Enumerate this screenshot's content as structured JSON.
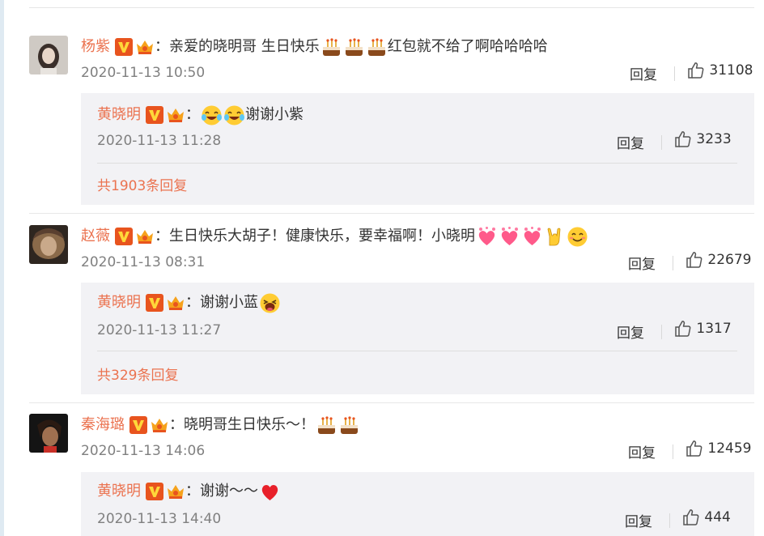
{
  "comments": [
    {
      "username": "杨紫",
      "text": "：亲爱的晓明哥 生日快乐",
      "emojis": [
        "cake-emoji",
        "cake-emoji",
        "cake-emoji"
      ],
      "text_after": "红包就不给了啊哈哈哈哈",
      "time": "2020-11-13 10:50",
      "reply_label": "回复",
      "likes": "31108",
      "reply": {
        "username": "黄晓明",
        "text": "：",
        "emojis": [
          "laugh-cry-emoji",
          "laugh-cry-emoji"
        ],
        "text_after": "谢谢小紫",
        "time": "2020-11-13 11:28",
        "reply_label": "回复",
        "likes": "3233"
      },
      "more_replies": "共1903条回复"
    },
    {
      "username": "赵薇",
      "text": "：生日快乐大胡子！健康快乐，要幸福啊！小晓明",
      "emojis": [
        "heart-cluster-emoji",
        "heart-cluster-emoji",
        "heart-cluster-emoji",
        "rock-hand-emoji",
        "smile-emoji"
      ],
      "text_after": "",
      "time": "2020-11-13 08:31",
      "reply_label": "回复",
      "likes": "22679",
      "reply": {
        "username": "黄晓明",
        "text": "：谢谢小蓝",
        "emojis": [
          "grin-emoji"
        ],
        "text_after": "",
        "time": "2020-11-13 11:27",
        "reply_label": "回复",
        "likes": "1317"
      },
      "more_replies": "共329条回复"
    },
    {
      "username": "秦海璐",
      "text": "：晓明哥生日快乐～！",
      "emojis": [
        "cake-emoji",
        "cake-emoji"
      ],
      "text_after": "",
      "time": "2020-11-13 14:06",
      "reply_label": "回复",
      "likes": "12459",
      "reply": {
        "username": "黄晓明",
        "text": "：谢谢～～",
        "emojis": [
          "red-heart-emoji"
        ],
        "text_after": "",
        "time": "2020-11-13 14:40",
        "reply_label": "回复",
        "likes": "444"
      }
    }
  ],
  "colors": {
    "username": "#eb7350",
    "time": "#808080",
    "reply_bg": "#f2f2f5",
    "badge_v": "#e8541e"
  },
  "icons": [
    "verified-v-icon",
    "member-crown-icon",
    "thumbs-up-icon"
  ]
}
